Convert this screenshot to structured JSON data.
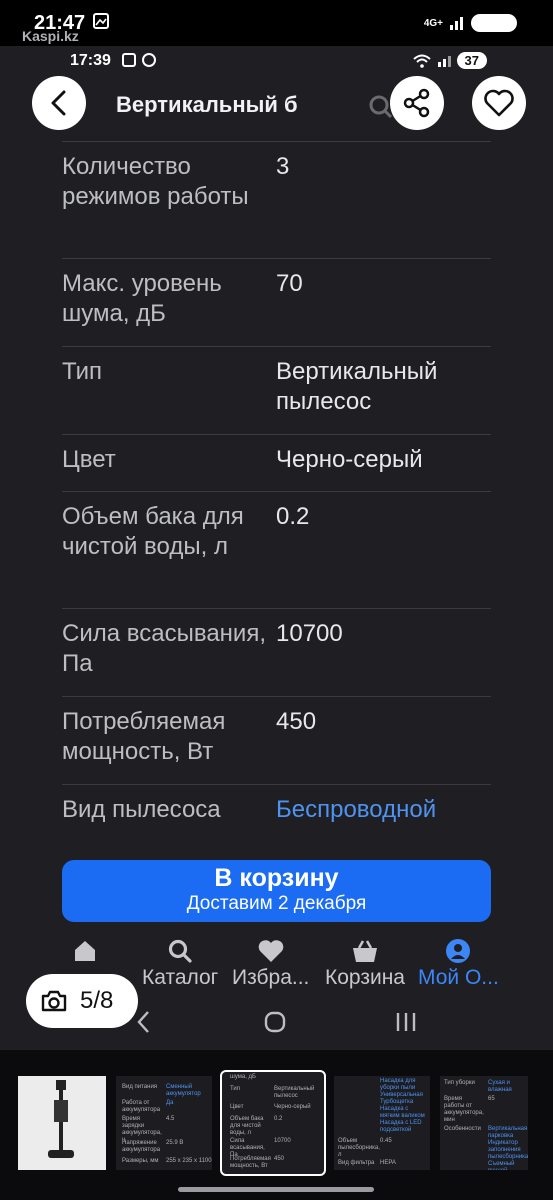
{
  "outer_status": {
    "time": "21:47",
    "network": "4G+",
    "watermark": "Kaspi.kz"
  },
  "inner_status": {
    "time": "17:39",
    "battery": "37"
  },
  "header": {
    "title": "Вертикальный б"
  },
  "specs": [
    {
      "label": "Количество режимов работы",
      "value": "3"
    },
    {
      "label": "Макс. уровень шума, дБ",
      "value": "70"
    },
    {
      "label": "Тип",
      "value": "Вертикальный пылесос"
    },
    {
      "label": "Цвет",
      "value": "Черно-серый"
    },
    {
      "label": "Объем бака для чистой воды, л",
      "value": "0.2"
    },
    {
      "label": "Сила всасывания, Па",
      "value": "10700"
    },
    {
      "label": "Потребляемая мощность, Вт",
      "value": "450"
    },
    {
      "label": "Вид пылесоса",
      "value": "Беспроводной",
      "link": true
    }
  ],
  "cart_button": {
    "label": "В корзину",
    "sublabel": "Доставим 2 декабря"
  },
  "bottom_nav": [
    {
      "label": "",
      "icon": "home-icon"
    },
    {
      "label": "Каталог",
      "icon": "search-icon"
    },
    {
      "label": "Избра...",
      "icon": "heart-icon"
    },
    {
      "label": "Корзина",
      "icon": "basket-icon"
    },
    {
      "label": "Мой О...",
      "icon": "user-icon",
      "active": true
    }
  ],
  "gallery": {
    "counter": "5/8"
  },
  "thumbnails": {
    "t2": [
      [
        "Вид питания",
        "Сменный аккумулятор"
      ],
      [
        "Работа от аккумулятора",
        "Да"
      ],
      [
        "Время зарядки аккумулятора, ч",
        "4.5"
      ],
      [
        "Напряжение аккумулятора",
        "25.9 В"
      ],
      [
        "Размеры, мм",
        "255 x 235 x 1100"
      ]
    ],
    "t3": [
      [
        "шума, дБ",
        ""
      ],
      [
        "Тип",
        "Вертикальный пылесос"
      ],
      [
        "Цвет",
        "Черно-серый"
      ],
      [
        "Объем бака для чистой воды, л",
        "0.2"
      ],
      [
        "Сила всасывания, Па",
        "10700"
      ],
      [
        "Потребляемая мощность, Вт",
        "450"
      ]
    ],
    "t4": [
      [
        "",
        "Насадка для уборки пыли Универсальная Турбощетка Насадка с мягким валиком Насадка с LED подсветкой"
      ],
      [
        "Объем пылесборника, л",
        "0.45"
      ],
      [
        "Вид фильтра",
        "HEPA"
      ]
    ],
    "t5": [
      [
        "Тип уборки",
        "Сухая и влажная"
      ],
      [
        "Время работы от аккумулятора, мин",
        "65"
      ],
      [
        "Особенности",
        "Вертикальная парковка Индикатор заполнения пылесборника Съемный ручной пылесос"
      ]
    ]
  },
  "colors": {
    "accent": "#1b6cf2",
    "link": "#4f93f0",
    "background": "#1e1e23"
  }
}
